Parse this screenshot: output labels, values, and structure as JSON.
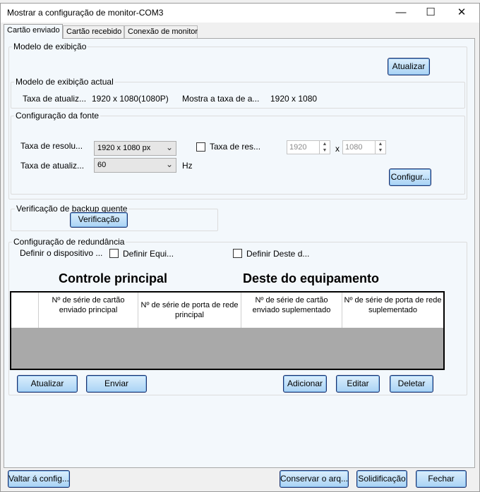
{
  "window": {
    "title": "Mostrar a configuração de monitor-COM3",
    "minimize_glyph": "—",
    "maximize_glyph": "☐",
    "close_glyph": "✕"
  },
  "tabs": [
    "Cartão enviado",
    "Cartão recebido",
    "Conexão de monitor"
  ],
  "display_mode": {
    "title": "Modelo de exibição",
    "refresh_button": "Atualizar",
    "current": {
      "title": "Modelo de exibição actual",
      "refresh_label": "Taxa de atualiz...",
      "refresh_value": "1920 x 1080(1080P)",
      "show_rate_label": "Mostra a taxa de a...",
      "show_rate_value": "1920 x 1080"
    },
    "source": {
      "title": "Configuração da fonte",
      "resolution_label": "Taxa de resolu...",
      "resolution_value": "1920 x 1080 px",
      "custom_res_label": "Taxa de res...",
      "width_value": "1920",
      "x_sep": "x",
      "height_value": "1080",
      "refresh_label": "Taxa de atualiz...",
      "refresh_value": "60",
      "hz_unit": "Hz",
      "config_button": "Configur..."
    }
  },
  "hot_backup": {
    "title": "Verificação de backup quente",
    "button": "Verificação"
  },
  "redundancy": {
    "title": "Configuração de redundância",
    "define_label": "Definir o dispositivo ...",
    "define_main_label": "Definir Equi...",
    "define_backup_label": "Definir Deste d...",
    "main_heading": "Controle principal",
    "backup_heading": "Deste do equipamento",
    "columns": [
      "Nº de série  de cartão enviado principal",
      "Nº de série de porta de rede principal",
      "Nº de série de cartão enviado suplementado",
      "Nº de série de porta de rede suplementado"
    ],
    "buttons": {
      "refresh": "Atualizar",
      "send": "Enviar",
      "add": "Adicionar",
      "edit": "Editar",
      "delete": "Deletar"
    }
  },
  "footer": {
    "back": "Valtar á config...",
    "save": "Conservar o arq...",
    "solidify": "Solidificação",
    "close": "Fechar"
  },
  "colors": {
    "button_top": "#dbeefc",
    "button_bottom": "#a9d3f5",
    "button_border": "#1c2f6a",
    "panel_bg": "#f3f8fc",
    "grid_bg": "#a9a9a9"
  }
}
